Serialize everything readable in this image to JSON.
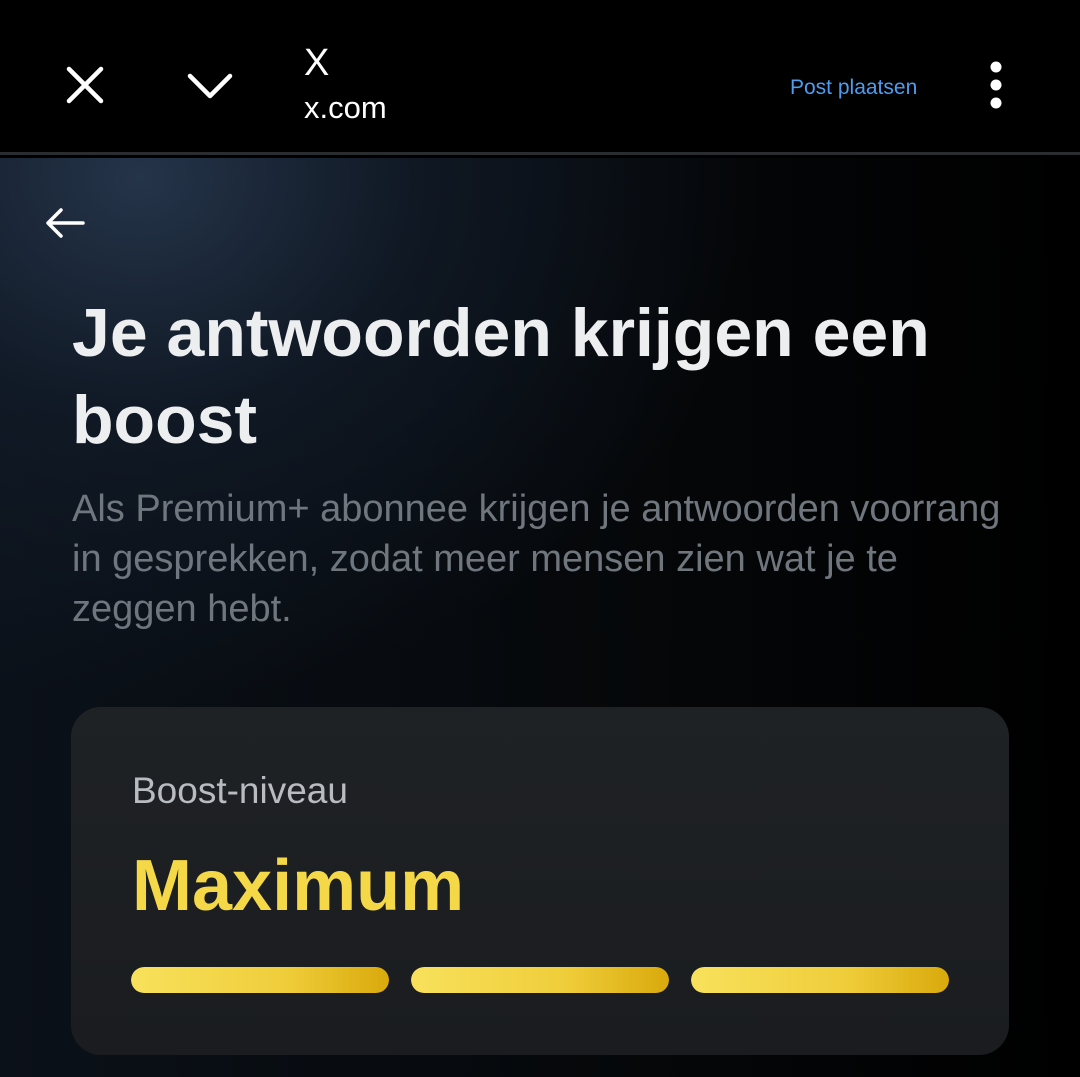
{
  "topbar": {
    "close_icon": "close-icon",
    "chevron_icon": "chevron-down-icon",
    "site_title": "X",
    "site_domain": "x.com",
    "post_link": "Post plaatsen",
    "more_icon": "more-vertical-icon",
    "link_color": "#4d9cf0"
  },
  "page": {
    "back_icon": "arrow-left-icon",
    "headline": "Je antwoorden krijgen een boost",
    "subtext": "Als Premium+ abonnee krijgen je antwoorden voorrang in gesprekken, zodat meer mensen zien wat je te zeggen hebt."
  },
  "boost_card": {
    "label": "Boost-niveau",
    "value": "Maximum",
    "value_color": "#f5d848",
    "level_filled": 3,
    "level_total": 3
  }
}
